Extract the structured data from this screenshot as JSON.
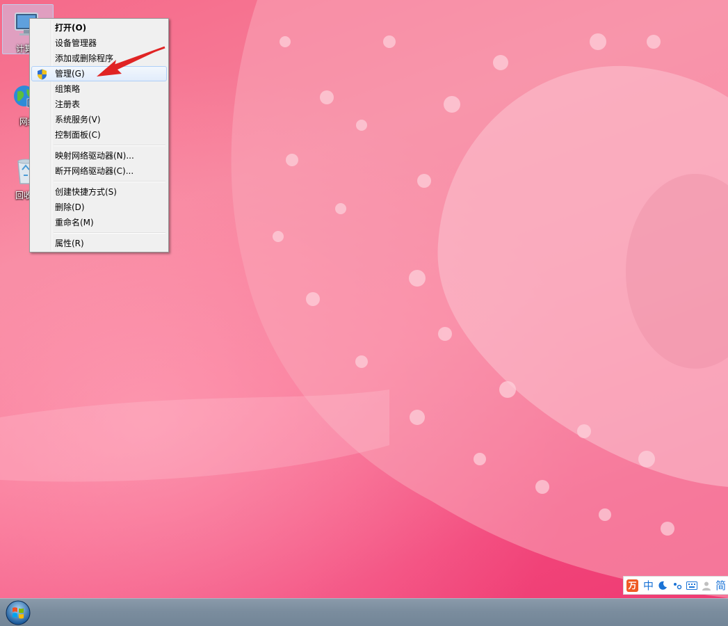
{
  "desktop": {
    "icons": [
      {
        "label": "计算机"
      },
      {
        "label": "网络"
      },
      {
        "label": "回收站"
      }
    ]
  },
  "context_menu": {
    "groups": [
      [
        {
          "label": "打开(O)",
          "bold": true
        },
        {
          "label": "设备管理器"
        },
        {
          "label": "添加或删除程序"
        },
        {
          "label": "管理(G)",
          "highlighted": true,
          "icon": "uac-shield-icon"
        },
        {
          "label": "组策略"
        },
        {
          "label": "注册表"
        },
        {
          "label": "系统服务(V)"
        },
        {
          "label": "控制面板(C)"
        }
      ],
      [
        {
          "label": "映射网络驱动器(N)..."
        },
        {
          "label": "断开网络驱动器(C)..."
        }
      ],
      [
        {
          "label": "创建快捷方式(S)"
        },
        {
          "label": "删除(D)"
        },
        {
          "label": "重命名(M)"
        }
      ],
      [
        {
          "label": "属性(R)"
        }
      ]
    ]
  },
  "ime_bar": {
    "logo": "万",
    "mode": "中",
    "layout": "简"
  },
  "colors": {
    "accent_arrow": "#e02424",
    "menu_highlight": "#e1ecfb"
  }
}
